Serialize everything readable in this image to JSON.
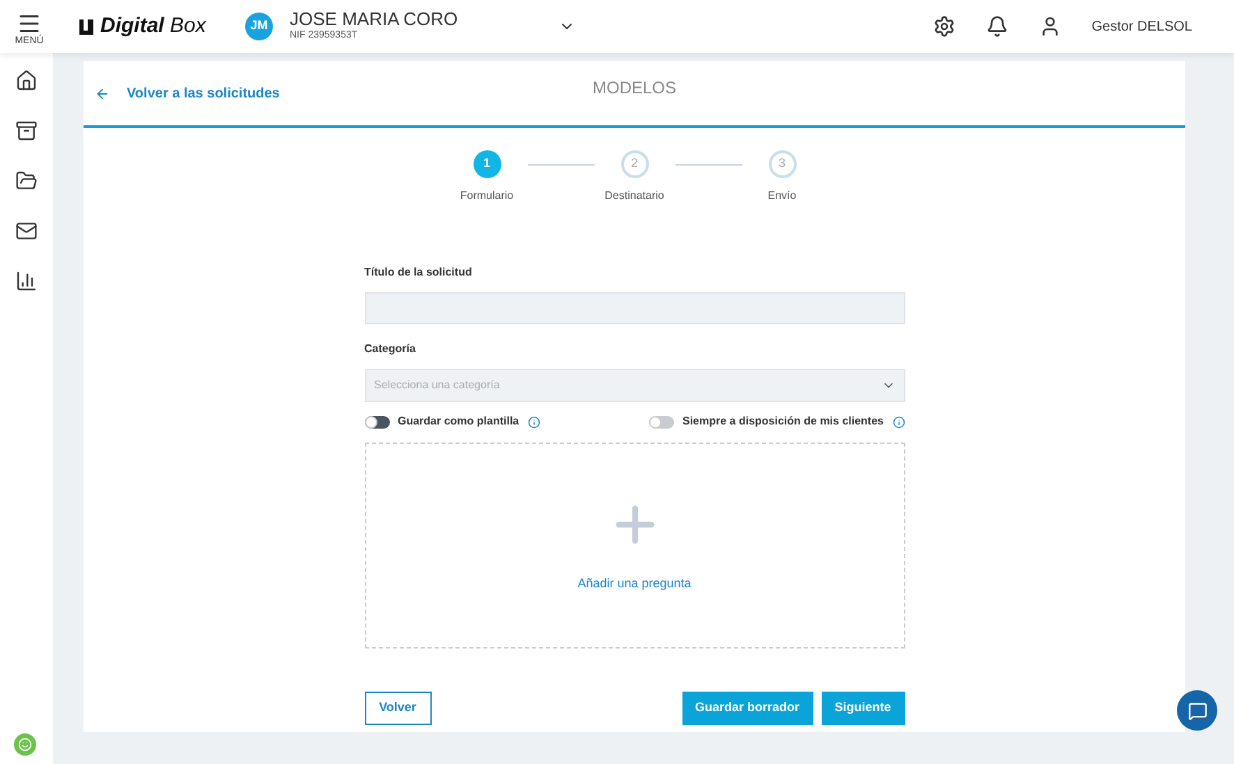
{
  "topbar": {
    "menu_label": "MENÚ",
    "brand_bold": "Digital",
    "brand_light": "Box",
    "avatar": "JM",
    "client_name": "JOSE MARIA CORO",
    "client_nif": "NIF 23959353T",
    "user": "Gestor DELSOL"
  },
  "header": {
    "back_link": "Volver a las solicitudes",
    "title": "MODELOS"
  },
  "steps": [
    {
      "number": "1",
      "label": "Formulario",
      "selected": true
    },
    {
      "number": "2",
      "label": "Destinatario",
      "selected": false
    },
    {
      "number": "3",
      "label": "Envío",
      "selected": false
    }
  ],
  "form": {
    "title_label": "Título de la solicitud",
    "category_label": "Categoría",
    "category_placeholder": "Selecciona una categoría",
    "toggles": [
      {
        "label": "Guardar como plantilla",
        "disabled": false
      },
      {
        "label": "Siempre a disposición de mis clientes",
        "disabled": true
      }
    ],
    "add_question": "Añadir una pregunta"
  },
  "buttons": {
    "back": "Volver",
    "draft": "Guardar borrador",
    "next": "Siguiente"
  }
}
